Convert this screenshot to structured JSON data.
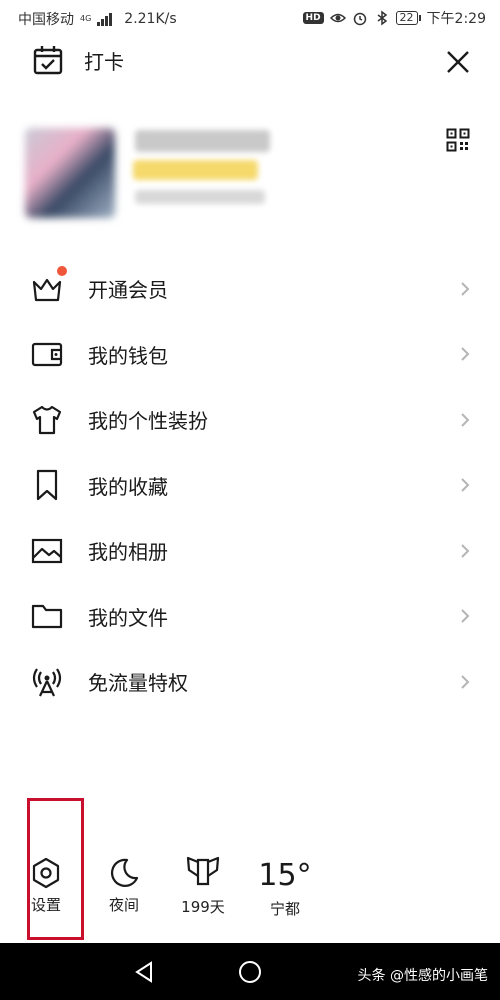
{
  "status_bar": {
    "carrier": "中国移动",
    "network": "4G",
    "speed": "2.21K/s",
    "hd_badge": "HD",
    "battery": "22",
    "time": "下午2:29"
  },
  "header": {
    "checkin_label": "打卡",
    "checkin_icon": "calendar-check-icon",
    "close_icon": "close-icon"
  },
  "profile": {
    "qr_icon": "qr-code-icon"
  },
  "menu": {
    "items": [
      {
        "label": "开通会员",
        "icon": "crown-icon",
        "has_badge": true
      },
      {
        "label": "我的钱包",
        "icon": "wallet-icon"
      },
      {
        "label": "我的个性装扮",
        "icon": "tshirt-icon"
      },
      {
        "label": "我的收藏",
        "icon": "bookmark-icon"
      },
      {
        "label": "我的相册",
        "icon": "image-icon"
      },
      {
        "label": "我的文件",
        "icon": "folder-icon"
      },
      {
        "label": "免流量特权",
        "icon": "signal-tower-icon"
      }
    ]
  },
  "bottom": {
    "settings_label": "设置",
    "night_label": "夜间",
    "days_label": "199天",
    "weather_temp": "15°",
    "weather_city": "宁都"
  },
  "nav": {
    "watermark": "头条 @性感的小画笔"
  },
  "colors": {
    "badge": "#f0563a",
    "highlight": "#c8102e"
  }
}
